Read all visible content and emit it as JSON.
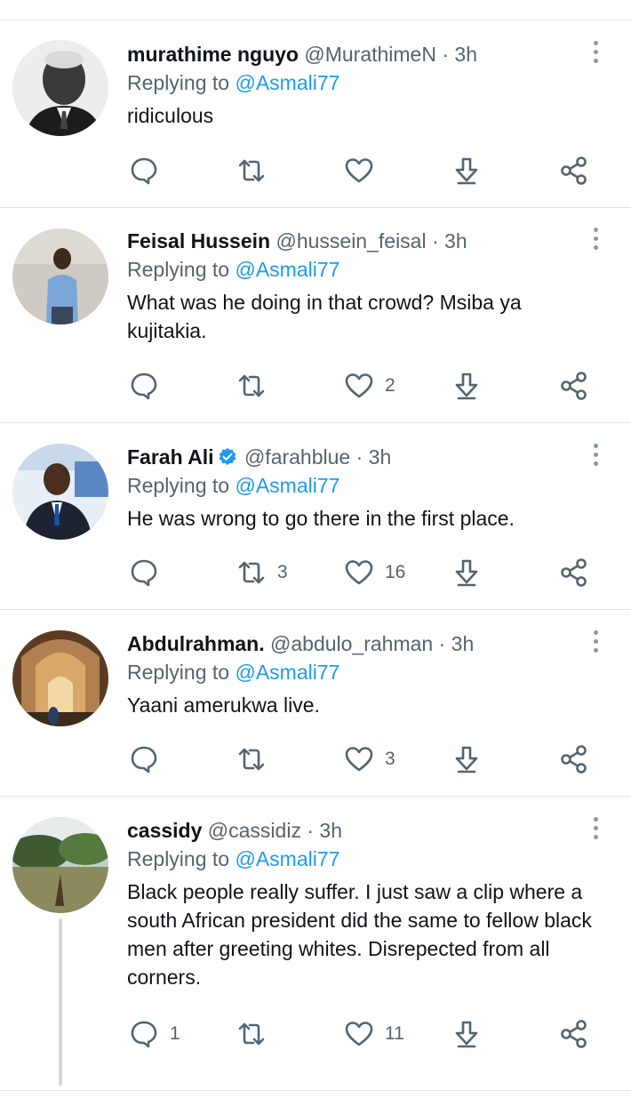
{
  "tweets": [
    {
      "name": "murathime nguyo",
      "handle": "@MurathimeN",
      "time": "3h",
      "replying_prefix": "Replying to",
      "replying_to": "@Asmali77",
      "text": "ridiculous",
      "replies": "",
      "retweets": "",
      "likes": ""
    },
    {
      "name": "Feisal Hussein",
      "handle": "@hussein_feisal",
      "time": "3h",
      "replying_prefix": "Replying to",
      "replying_to": "@Asmali77",
      "text": "What was he doing in that crowd? Msiba ya kujitakia.",
      "replies": "",
      "retweets": "",
      "likes": "2"
    },
    {
      "name": "Farah Ali",
      "verified": true,
      "handle": "@farahblue",
      "time": "3h",
      "replying_prefix": "Replying to",
      "replying_to": "@Asmali77",
      "text": "He was wrong to go there in the first place.",
      "replies": "",
      "retweets": "3",
      "likes": "16"
    },
    {
      "name": "Abdulrahman.",
      "handle": "@abdulo_rahman",
      "time": "3h",
      "replying_prefix": "Replying to",
      "replying_to": "@Asmali77",
      "text": "Yaani amerukwa live.",
      "replies": "",
      "retweets": "",
      "likes": "3"
    },
    {
      "name": "cassidy",
      "handle": "@cassidiz",
      "time": "3h",
      "replying_prefix": "Replying to",
      "replying_to": "@Asmali77",
      "text": "Black people really suffer. I just saw a clip where a south African president did the same to fellow black men after greeting whites. Disrepected from all corners.",
      "replies": "1",
      "retweets": "",
      "likes": "11"
    }
  ],
  "separator": "·",
  "icons": [
    "more-options-icon",
    "reply-icon",
    "retweet-icon",
    "like-icon",
    "download-icon",
    "share-icon",
    "verified-badge-icon"
  ],
  "colors": {
    "accent": "#1d9bf0",
    "secondary_text": "#536471",
    "primary_text": "#0f1419"
  }
}
